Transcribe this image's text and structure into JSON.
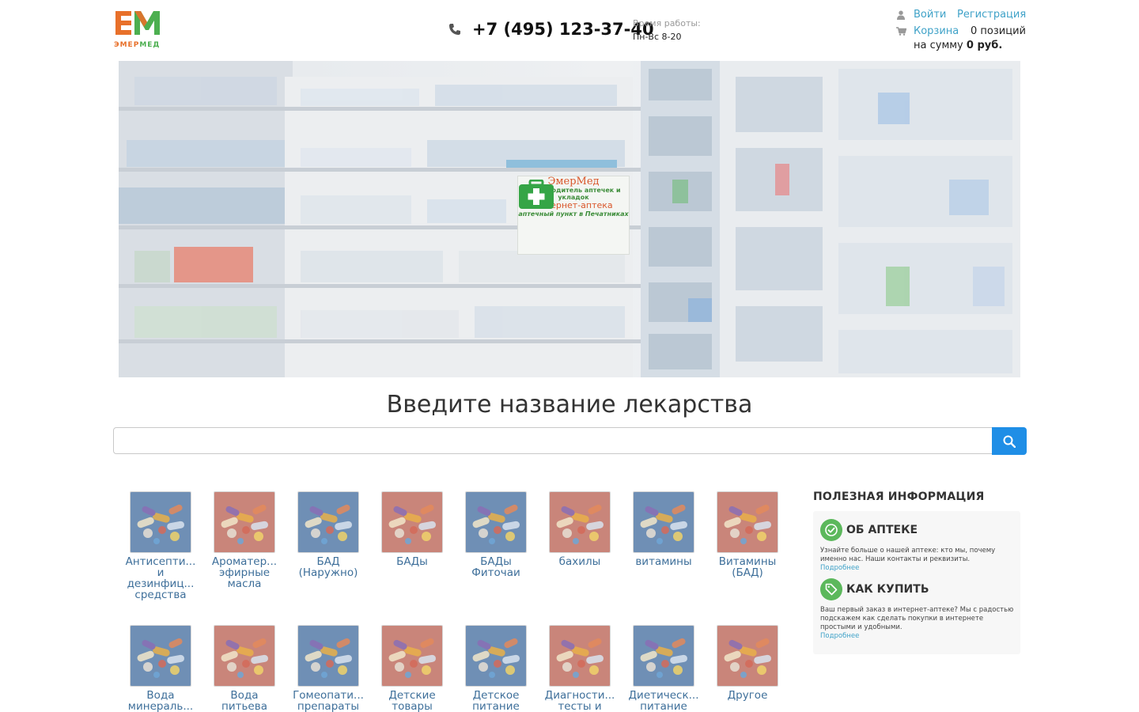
{
  "header": {
    "logo_em": "ЭМЕР",
    "logo_med": "МЕД",
    "phone": "+7 (495) 123-37-40",
    "hours_label": "Время работы:",
    "hours_value": "Пн-Вс 8-20",
    "login": "Войти",
    "register": "Регистрация",
    "cart_label": "Корзина",
    "cart_count": "0 позиций",
    "cart_sum_prefix": "на сумму",
    "cart_sum_value": "0 руб."
  },
  "banner": {
    "sign_name": "ЭмерМед",
    "sign_line1": "производитель аптечек и укладок",
    "sign_line2": "интернет-аптека",
    "sign_line3": "аптечный пункт в Печатниках"
  },
  "search": {
    "title": "Введите название лекарства",
    "placeholder": ""
  },
  "categories": [
    {
      "label": "Антисептические и дезинфицирующие средства",
      "lines": [
        "Антисепти...",
        "и",
        "дезинфиц...",
        "средства"
      ],
      "tint": "blue"
    },
    {
      "label": "Ароматерапия эфирные масла",
      "lines": [
        "Ароматер...",
        "эфирные",
        "масла"
      ],
      "tint": "red"
    },
    {
      "label": "БАД (Наружно)",
      "lines": [
        "БАД",
        "(Наружно)"
      ],
      "tint": "blue"
    },
    {
      "label": "БАДы",
      "lines": [
        "БАДы"
      ],
      "tint": "red"
    },
    {
      "label": "БАДы Фиточаи",
      "lines": [
        "БАДы",
        "Фиточаи"
      ],
      "tint": "blue"
    },
    {
      "label": "бахилы",
      "lines": [
        "бахилы"
      ],
      "tint": "red"
    },
    {
      "label": "витамины",
      "lines": [
        "витамины"
      ],
      "tint": "blue"
    },
    {
      "label": "Витамины (БАД)",
      "lines": [
        "Витамины",
        "(БАД)"
      ],
      "tint": "red"
    },
    {
      "label": "Вода минеральная",
      "lines": [
        "Вода",
        "минераль..."
      ],
      "tint": "blue"
    },
    {
      "label": "Вода питьевая",
      "lines": [
        "Вода",
        "питьева"
      ],
      "tint": "red"
    },
    {
      "label": "Гомеопатические препараты",
      "lines": [
        "Гомеопати...",
        "препараты"
      ],
      "tint": "blue"
    },
    {
      "label": "Детские товары",
      "lines": [
        "Детские",
        "товары"
      ],
      "tint": "red"
    },
    {
      "label": "Детское питание",
      "lines": [
        "Детское",
        "питание"
      ],
      "tint": "blue"
    },
    {
      "label": "Диагностические тесты и",
      "lines": [
        "Диагности...",
        "тесты и"
      ],
      "tint": "red"
    },
    {
      "label": "Диетическое питание",
      "lines": [
        "Диетическ...",
        "питание"
      ],
      "tint": "blue"
    },
    {
      "label": "Другое",
      "lines": [
        "Другое"
      ],
      "tint": "red"
    }
  ],
  "info": {
    "heading": "ПОЛЕЗНАЯ ИНФОРМАЦИЯ",
    "items": [
      {
        "title": "ОБ АПТЕКЕ",
        "text": "Узнайте больше о нашей аптеке: кто мы, почему именно нас. Наши контакты и реквизиты.",
        "more": "Подробнее",
        "icon": "check-badge-icon"
      },
      {
        "title": "КАК КУПИТЬ",
        "text": "Ваш первый заказ в интернет-аптеке? Мы с радостью подскажем как сделать покупки в интернете простыми и удобными.",
        "more": "Подробнее",
        "icon": "tag-icon"
      }
    ]
  },
  "colors": {
    "link": "#3fa2c8",
    "category_link": "#3e6f9a",
    "search_button": "#1f8ee6",
    "info_icon": "#5cb85c",
    "thumb_blue": "#6f8fb5",
    "thumb_red": "#c9857a"
  }
}
